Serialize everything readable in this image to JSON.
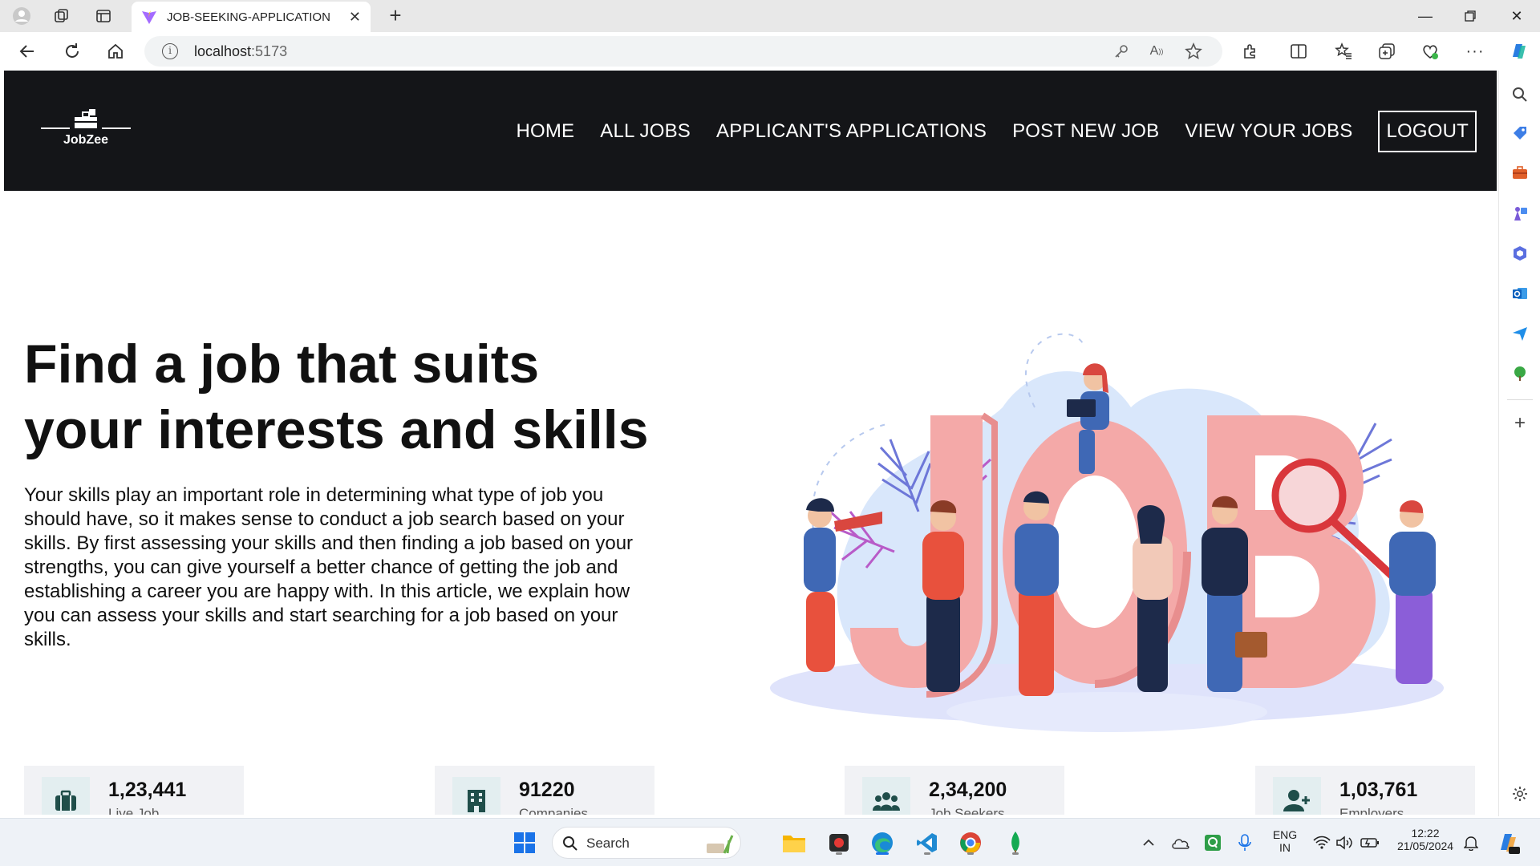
{
  "browser": {
    "tab_title": "JOB-SEEKING-APPLICATION",
    "url_host": "localhost",
    "url_port": ":5173"
  },
  "navbar": {
    "logo_text": "JobZee",
    "links": [
      "HOME",
      "ALL JOBS",
      "APPLICANT'S APPLICATIONS",
      "POST NEW JOB",
      "VIEW YOUR JOBS"
    ],
    "logout_label": "LOGOUT"
  },
  "hero": {
    "title_line1": "Find a job that suits",
    "title_line2": "your interests and skills",
    "description": "Your skills play an important role in determining what type of job you should have, so it makes sense to conduct a job search based on your skills. By first assessing your skills and then finding a job based on your strengths, you can give yourself a better chance of getting the job and establishing a career you are happy with. In this article, we explain how you can assess your skills and start searching for a job based on your skills.",
    "illustration_text": "JOB"
  },
  "stats": [
    {
      "value": "1,23,441",
      "label": "Live Job",
      "icon": "briefcase-icon"
    },
    {
      "value": "91220",
      "label": "Companies",
      "icon": "building-icon"
    },
    {
      "value": "2,34,200",
      "label": "Job Seekers",
      "icon": "users-icon"
    },
    {
      "value": "1,03,761",
      "label": "Employers",
      "icon": "user-plus-icon"
    }
  ],
  "taskbar": {
    "search_label": "Search",
    "lang_line1": "ENG",
    "lang_line2": "IN",
    "time": "12:22",
    "date": "21/05/2024"
  },
  "colors": {
    "navbar_bg": "#141518",
    "stat_card_bg": "#f1f2f5",
    "icon_teal": "#1f4e4a",
    "job_letters": "#f4a9a8",
    "edge_accent": "#0078d4"
  }
}
